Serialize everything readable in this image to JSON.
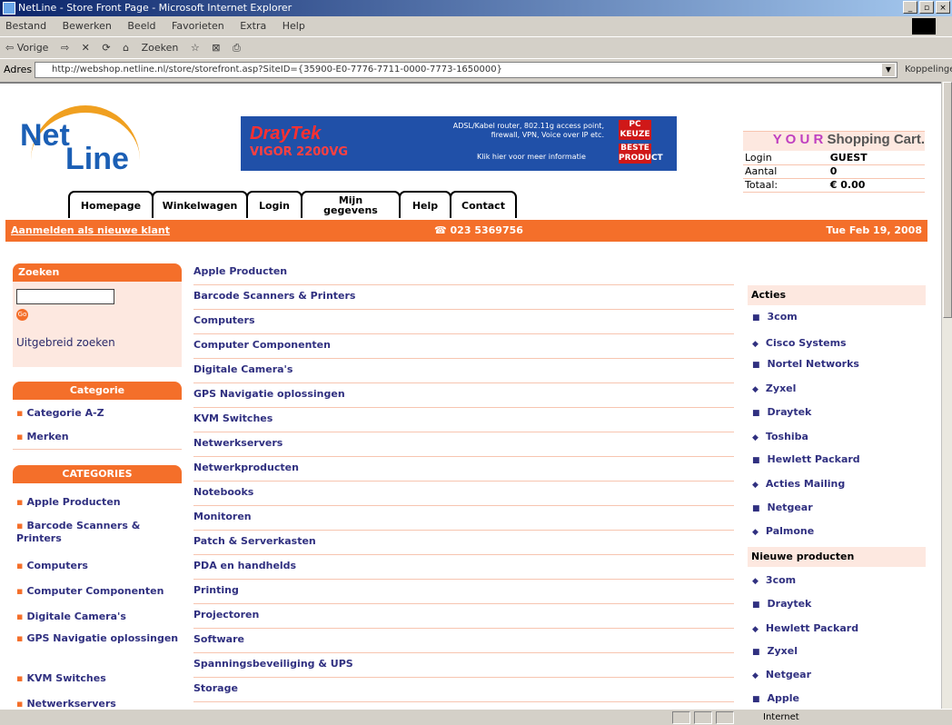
{
  "window": {
    "title": "NetLine - Store Front Page - Microsoft Internet Explorer",
    "buttons": [
      "_",
      "▫",
      "×"
    ]
  },
  "menu": [
    "Bestand",
    "Bewerken",
    "Beeld",
    "Favorieten",
    "Extra",
    "Help"
  ],
  "toolbar": [
    "⇦ Vorige",
    "⇨",
    "✕",
    "⟳",
    "⌂",
    "Zoeken",
    "☆",
    "⊠",
    "⎙"
  ],
  "address": {
    "label": "Adres",
    "url": "http://webshop.netline.nl/store/storefront.asp?SiteID={35900-E0-7776-7711-0000-7773-1650000}",
    "links": "Koppelingen"
  },
  "status": {
    "zone": "Internet"
  },
  "logo": {
    "part1": "Net",
    "part2": "Line"
  },
  "banner": {
    "brand": "DrayTek",
    "model": "VIGOR 2200VG",
    "text": "ADSL/Kabel router, 802.11g access point, firewall, VPN, Voice over IP etc.",
    "link": "Klik hier voor meer informatie",
    "badge1": "PC KEUZE",
    "badge2": "BESTE PRODUCT"
  },
  "cart": {
    "title_icon": "Y O U R",
    "title": "Shopping Cart.",
    "rows": [
      {
        "k": "Login",
        "v": "GUEST"
      },
      {
        "k": "Aantal",
        "v": "0"
      },
      {
        "k": "Totaal:",
        "v": "€ 0.00"
      }
    ]
  },
  "tabs": [
    "Homepage",
    "Winkelwagen",
    "Login",
    "Mijn gegevens",
    "Help",
    "Contact"
  ],
  "bar": {
    "register": "Aanmelden als nieuwe klant",
    "phone": "☎ 023 5369756",
    "date": "Tue Feb 19, 2008"
  },
  "search": {
    "title": "Zoeken",
    "go": "Go",
    "advanced": "Uitgebreid zoeken"
  },
  "categorie": {
    "title": "Categorie",
    "items": [
      "Categorie A-Z",
      "Merken"
    ]
  },
  "categories": {
    "title": "CATEGORIES",
    "items": [
      "Apple Producten",
      "Barcode Scanners & Printers",
      "Computers",
      "Computer Componenten",
      "Digitale Camera's",
      "GPS Navigatie oplossingen",
      "KVM Switches",
      "Netwerkservers"
    ]
  },
  "center": [
    "Apple Producten",
    "Barcode Scanners & Printers",
    "Computers",
    "Computer Componenten",
    "Digitale Camera's",
    "GPS Navigatie oplossingen",
    "KVM Switches",
    "Netwerkservers",
    "Netwerkproducten",
    "Notebooks",
    "Monitoren",
    "Patch & Serverkasten",
    "PDA en handhelds",
    "Printing",
    "Projectoren",
    "Software",
    "Spanningsbeveiliging & UPS",
    "Storage"
  ],
  "acties": {
    "title": "Acties",
    "items": [
      "3com",
      "Cisco Systems",
      "Nortel Networks",
      "Zyxel",
      "Draytek",
      "Toshiba",
      "Hewlett Packard",
      "Acties Mailing",
      "Netgear",
      "Palmone"
    ]
  },
  "nieuwe": {
    "title": "Nieuwe producten",
    "items": [
      "3com",
      "Draytek",
      "Hewlett Packard",
      "Zyxel",
      "Netgear",
      "Apple"
    ]
  }
}
